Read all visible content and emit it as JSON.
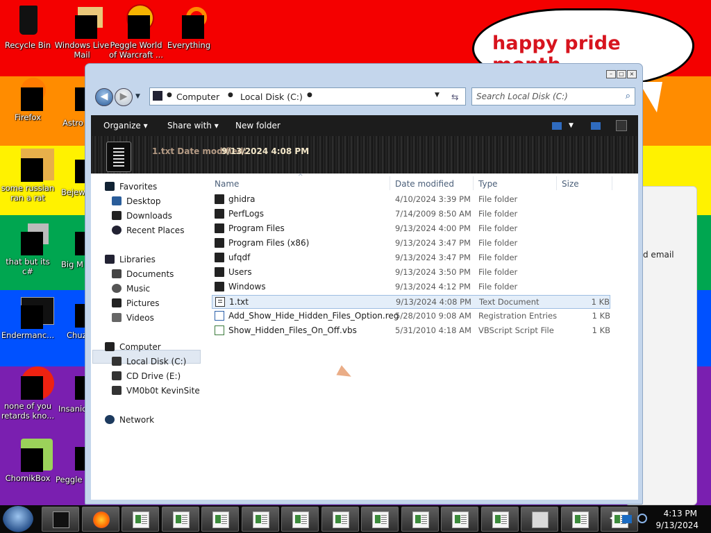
{
  "colors": {
    "rainbow": [
      "#f40000",
      "#ff8c00",
      "#fff200",
      "#00a650",
      "#0051ff",
      "#7a1fb0"
    ],
    "explorer_frame": "#c4d6ec",
    "toolbar_bg": "#1c1c1c",
    "bubble_text": "#d7141e",
    "taskbar_bg": "#0a0a0a"
  },
  "desktop": {
    "icons": [
      {
        "label": "Recycle Bin",
        "icon": "recycle-bin-icon"
      },
      {
        "label": "Windows Live Mail",
        "icon": "windows-live-mail-icon"
      },
      {
        "label": "Peggle World of Warcraft ...",
        "icon": "peggle-icon"
      },
      {
        "label": "Everything",
        "icon": "everything-search-icon"
      },
      {
        "label": "Firefox",
        "icon": "firefox-icon"
      },
      {
        "label": "Astro Delu",
        "icon": "astro-icon"
      },
      {
        "label": "some russian ran a rat",
        "icon": "app-icon"
      },
      {
        "label": "Bejew Delu",
        "icon": "bejeweled-icon"
      },
      {
        "label": "that but its c#",
        "icon": "app-icon"
      },
      {
        "label": "Big M Delu",
        "icon": "app-icon"
      },
      {
        "label": "Endermanc...",
        "icon": "app-icon"
      },
      {
        "label": "Chuz Delu",
        "icon": "app-icon"
      },
      {
        "label": "none of you retards kno...",
        "icon": "app-icon"
      },
      {
        "label": "Insaniq Delu",
        "icon": "app-icon"
      },
      {
        "label": "ChomikBox",
        "icon": "chomikbox-icon"
      },
      {
        "label": "Peggle",
        "icon": "peggle-icon"
      }
    ],
    "bubble_text": "happy pride month",
    "background_panel_text": "d email"
  },
  "explorer": {
    "address": {
      "root": "Computer",
      "folder": "Local Disk (C:)"
    },
    "search_placeholder": "Search Local Disk (C:)",
    "toolbar": {
      "organize": "Organize",
      "share_with": "Share with",
      "new_folder": "New folder"
    },
    "details": {
      "date_modified": "9/13/2024 4:08 PM",
      "ghost_text": "1.txt Date modified:"
    },
    "nav": {
      "favorites": "Favorites",
      "desktop": "Desktop",
      "downloads": "Downloads",
      "recent_places": "Recent Places",
      "libraries": "Libraries",
      "documents": "Documents",
      "music": "Music",
      "pictures": "Pictures",
      "videos": "Videos",
      "computer": "Computer",
      "local_disk": "Local Disk (C:)",
      "cd_drive": "CD Drive (E:)",
      "network_drive": "VM0b0t KevinSite",
      "network": "Network"
    },
    "columns": {
      "name": "Name",
      "date": "Date modified",
      "type": "Type",
      "size": "Size"
    },
    "files": [
      {
        "name": "ghidra",
        "date": "4/10/2024 3:39 PM",
        "type": "File folder",
        "size": "",
        "kind": "folder"
      },
      {
        "name": "PerfLogs",
        "date": "7/14/2009 8:50 AM",
        "type": "File folder",
        "size": "",
        "kind": "folder"
      },
      {
        "name": "Program Files",
        "date": "9/13/2024 4:00 PM",
        "type": "File folder",
        "size": "",
        "kind": "folder"
      },
      {
        "name": "Program Files (x86)",
        "date": "9/13/2024 3:47 PM",
        "type": "File folder",
        "size": "",
        "kind": "folder"
      },
      {
        "name": "ufqdf",
        "date": "9/13/2024 3:47 PM",
        "type": "File folder",
        "size": "",
        "kind": "folder"
      },
      {
        "name": "Users",
        "date": "9/13/2024 3:50 PM",
        "type": "File folder",
        "size": "",
        "kind": "folder"
      },
      {
        "name": "Windows",
        "date": "9/13/2024 4:12 PM",
        "type": "File folder",
        "size": "",
        "kind": "folder"
      },
      {
        "name": "1.txt",
        "date": "9/13/2024 4:08 PM",
        "type": "Text Document",
        "size": "1 KB",
        "kind": "txt",
        "selected": true
      },
      {
        "name": "Add_Show_Hide_Hidden_Files_Option.reg",
        "date": "5/28/2010 9:08 AM",
        "type": "Registration Entries",
        "size": "1 KB",
        "kind": "reg"
      },
      {
        "name": "Show_Hidden_Files_On_Off.vbs",
        "date": "5/31/2010 4:18 AM",
        "type": "VBScript Script File",
        "size": "1 KB",
        "kind": "vbs"
      }
    ]
  },
  "taskbar": {
    "clock_time": "4:13 PM",
    "clock_date": "9/13/2024",
    "apps": [
      "explorer-app-icon",
      "firefox-app-icon",
      "document-app-icon",
      "document-app-icon",
      "document-app-icon",
      "document-app-icon",
      "document-app-icon",
      "document-app-icon",
      "document-app-icon",
      "document-app-icon",
      "document-app-icon",
      "document-app-icon",
      "notepad-app-icon",
      "document-app-icon",
      "document-app-icon"
    ]
  }
}
